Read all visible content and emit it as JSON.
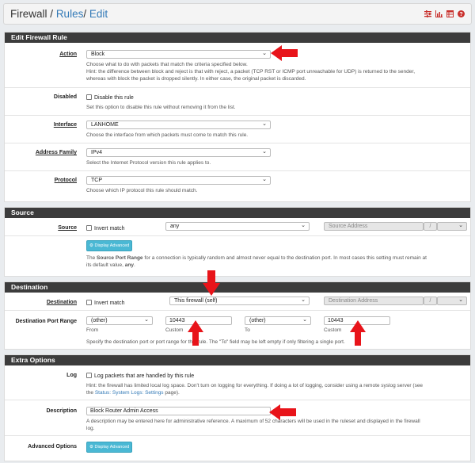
{
  "breadcrumb": {
    "firewall": "Firewall",
    "sep1": "/",
    "rules": "Rules",
    "sep2": "/",
    "edit": "Edit"
  },
  "header_icons": [
    "sliders-icon",
    "chart-icon",
    "table-icon",
    "help-icon"
  ],
  "edit": {
    "title": "Edit Firewall Rule",
    "action": {
      "label": "Action",
      "value": "Block",
      "help1": "Choose what to do with packets that match the criteria specified below.",
      "help2": "Hint: the difference between block and reject is that with reject, a packet (TCP RST or ICMP port unreachable for UDP) is returned to the sender,",
      "help3": "whereas with block the packet is dropped silently. In either case, the original packet is discarded."
    },
    "disabled": {
      "label": "Disabled",
      "checkbox": "Disable this rule",
      "help": "Set this option to disable this rule without removing it from the list."
    },
    "interface": {
      "label": "Interface",
      "value": "LANHOME",
      "help": "Choose the interface from which packets must come to match this rule."
    },
    "family": {
      "label": "Address Family",
      "value": "IPv4",
      "help": "Select the Internet Protocol version this rule applies to."
    },
    "protocol": {
      "label": "Protocol",
      "value": "TCP",
      "help": "Choose which IP protocol this rule should match."
    }
  },
  "source": {
    "title": "Source",
    "label": "Source",
    "invert": "Invert match",
    "type": "any",
    "address_placeholder": "Source Address",
    "slash": "/",
    "button": "Display Advanced",
    "help_pre": "The ",
    "help_bold": "Source Port Range",
    "help_mid": " for a connection is typically random and almost never equal to the destination port. In most cases this setting must remain at",
    "help2_pre": "its default value, ",
    "help2_bold": "any",
    "help2_post": "."
  },
  "destination": {
    "title": "Destination",
    "label": "Destination",
    "invert": "Invert match",
    "type": "This firewall (self)",
    "address_placeholder": "Destination Address",
    "slash": "/",
    "port_label": "Destination Port Range",
    "from_select": "(other)",
    "from_custom": "10443",
    "to_select": "(other)",
    "to_custom": "10443",
    "from_lbl": "From",
    "custom_lbl": "Custom",
    "to_lbl": "To",
    "custom_lbl2": "Custom",
    "help": "Specify the destination port or port range for this rule. The \"To\" field may be left empty if only filtering a single port."
  },
  "extra": {
    "title": "Extra Options",
    "log": {
      "label": "Log",
      "checkbox": "Log packets that are handled by this rule",
      "help1": "Hint: the firewall has limited local log space. Don't turn on logging for everything. If doing a lot of logging, consider using a remote syslog server (see",
      "help2_pre": "the ",
      "help2_link": "Status: System Logs: Settings",
      "help2_post": " page)."
    },
    "description": {
      "label": "Description",
      "value": "Block Router Admin Access",
      "help1": "A description may be entered here for administrative reference. A maximum of 52 characters will be used in the ruleset and displayed in the firewall",
      "help2": "log."
    },
    "advanced": {
      "label": "Advanced Options",
      "button": "Display Advanced"
    }
  },
  "colors": {
    "accent": "#337ab7",
    "panel_header": "#3c3c3c",
    "button": "#4ab8d4",
    "arrow": "#e8141a",
    "header_icon": "#c9302c"
  }
}
